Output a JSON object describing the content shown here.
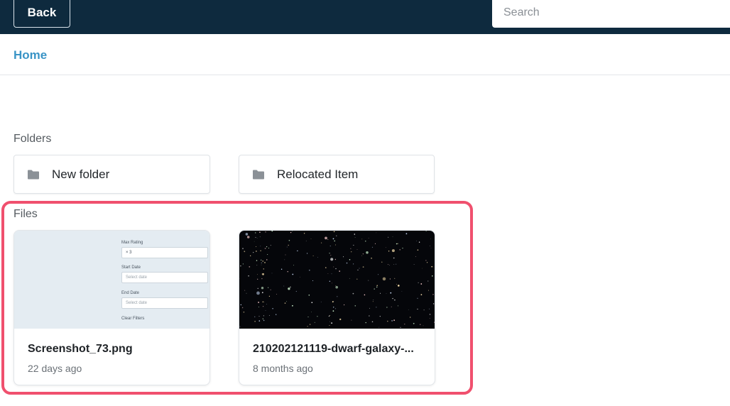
{
  "header": {
    "back_label": "Back",
    "search_placeholder": "Search"
  },
  "breadcrumb": {
    "home_label": "Home"
  },
  "folders_section": {
    "label": "Folders",
    "items": [
      {
        "name": "New folder",
        "icon": "folder-icon"
      },
      {
        "name": "Relocated Item",
        "icon": "folder-icon"
      }
    ]
  },
  "files_section": {
    "label": "Files",
    "items": [
      {
        "name": "Screenshot_73.png",
        "time": "22 days ago",
        "thumbnail": {
          "max_rating_label": "Max Rating",
          "max_rating_value": "3",
          "start_date_label": "Start Date",
          "start_date_placeholder": "Select date",
          "end_date_label": "End Date",
          "end_date_placeholder": "Select date",
          "clear_filters": "Clear Filters"
        }
      },
      {
        "name": "210202121119-dwarf-galaxy-...",
        "time": "8 months ago"
      }
    ]
  },
  "colors": {
    "topbar": "#0e2a3e",
    "link": "#3a94c6",
    "highlight": "#f0506e"
  }
}
